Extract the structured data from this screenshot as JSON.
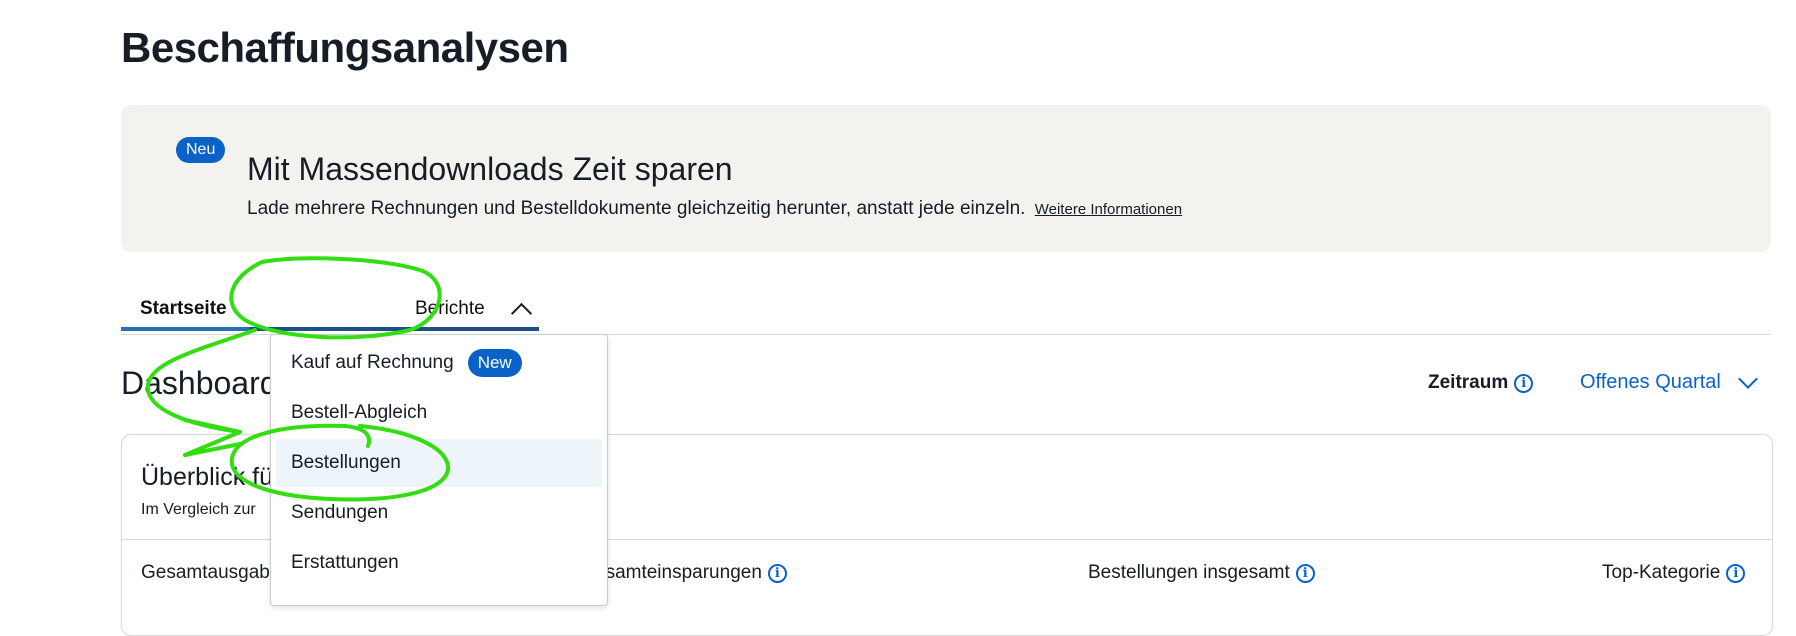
{
  "page_title": "Beschaffungsanalysen",
  "promo": {
    "badge": "Neu",
    "heading": "Mit Massendownloads Zeit sparen",
    "text": "Lade mehrere Rechnungen und Bestelldokumente gleichzeitig herunter, anstatt jede einzeln.",
    "link": "Weitere Informationen"
  },
  "tabs": [
    {
      "label": "Startseite"
    },
    {
      "label": "Berichte"
    }
  ],
  "reports_menu": {
    "items": [
      {
        "label": "Kauf auf Rechnung",
        "badge": "New"
      },
      {
        "label": "Bestell-Abgleich"
      },
      {
        "label": "Bestellungen"
      },
      {
        "label": "Sendungen"
      },
      {
        "label": "Erstattungen"
      }
    ]
  },
  "dashboard": {
    "title": "Dashboard",
    "period_label": "Zeitraum",
    "period_value": "Offenes Quartal"
  },
  "overview": {
    "title": "Überblick fü",
    "subtitle": "Im Vergleich zur",
    "metrics": [
      {
        "label": "Gesamtausgab"
      },
      {
        "label": "esamteinsparungen"
      },
      {
        "label": "Bestellungen insgesamt"
      },
      {
        "label": "Top-Kategorie"
      }
    ]
  },
  "colors": {
    "accent_blue": "#0a62c9",
    "annotation_green": "#33dd11",
    "promo_bg": "#f3f2ef"
  },
  "icons": [
    "info-icon",
    "chevron-up-icon",
    "chevron-down-icon"
  ]
}
